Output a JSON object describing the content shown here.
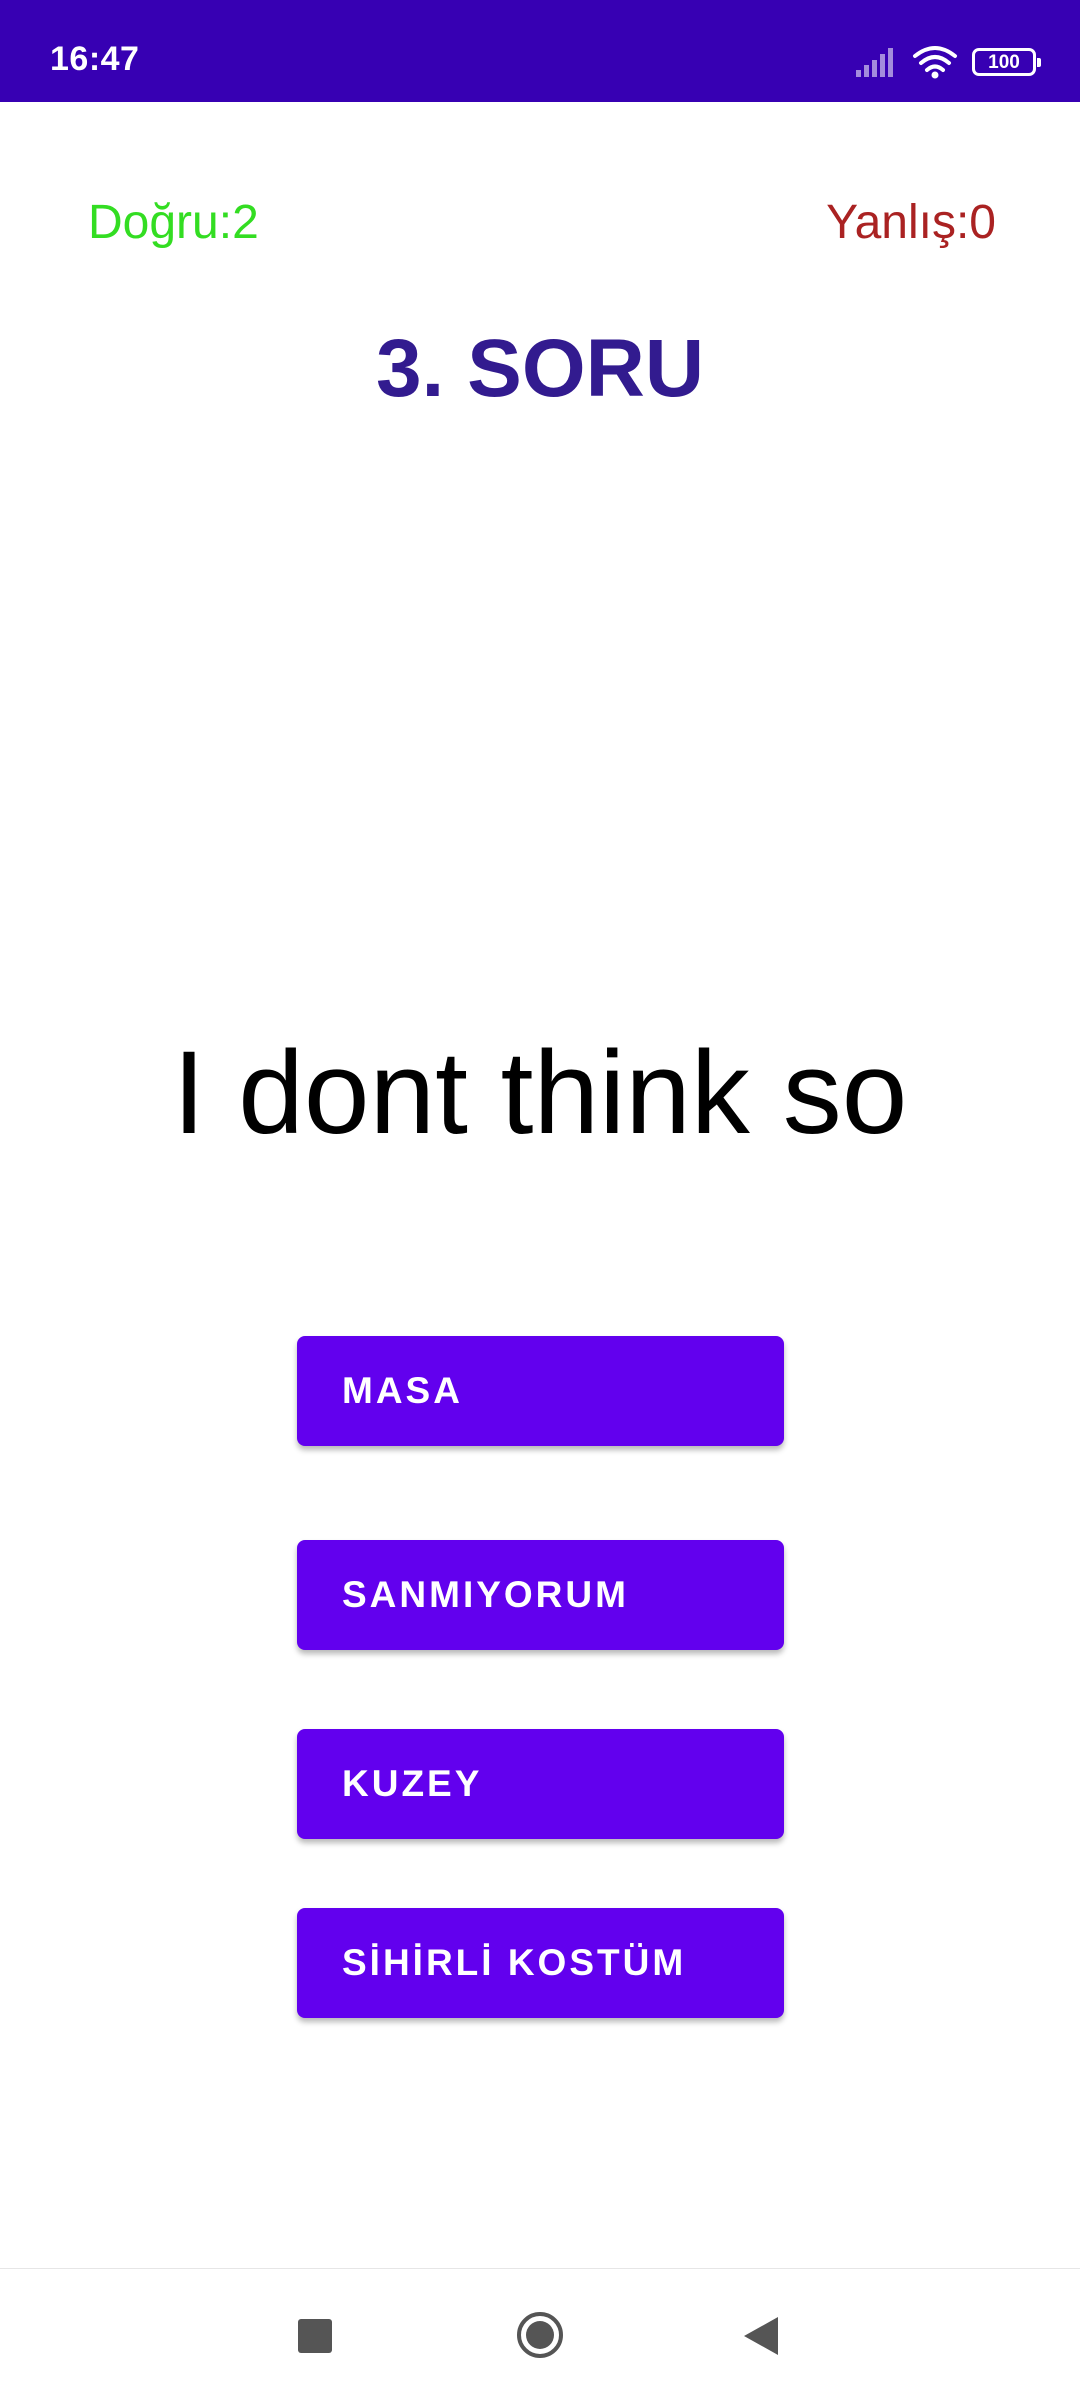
{
  "status_bar": {
    "time": "16:47",
    "battery_level": "100",
    "icons": [
      "signal-icon",
      "wifi-icon",
      "battery-icon"
    ],
    "background_color": "#3700b3"
  },
  "score": {
    "correct_label": "Doğru:2",
    "wrong_label": "Yanlış:0",
    "correct_color": "#33dd22",
    "wrong_color": "#aa2222"
  },
  "question": {
    "title": "3. SORU",
    "text": "I dont think so"
  },
  "answers": [
    {
      "label": "MASA"
    },
    {
      "label": "SANMIYORUM"
    },
    {
      "label": "KUZEY"
    },
    {
      "label": "SİHİRLİ KOSTÜM"
    }
  ],
  "theme": {
    "button_color": "#6200ee",
    "title_color": "#321b8f"
  },
  "nav_bar": {
    "icons": [
      "recents-icon",
      "home-icon",
      "back-icon"
    ]
  }
}
